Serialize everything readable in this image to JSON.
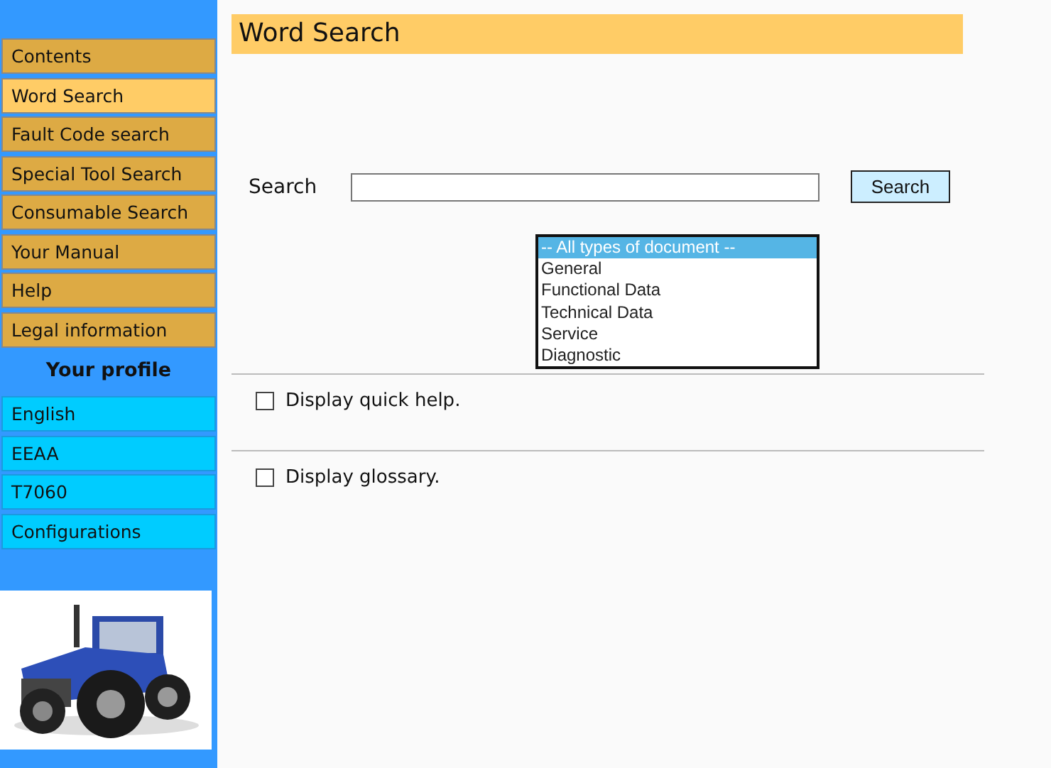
{
  "sidebar": {
    "menu": [
      {
        "label": "Contents",
        "selected": false
      },
      {
        "label": "Word Search",
        "selected": true
      },
      {
        "label": "Fault Code search",
        "selected": false
      },
      {
        "label": "Special Tool Search",
        "selected": false
      },
      {
        "label": "Consumable Search",
        "selected": false
      },
      {
        "label": "Your Manual",
        "selected": false
      },
      {
        "label": "Help",
        "selected": false
      },
      {
        "label": "Legal information",
        "selected": false
      }
    ],
    "profile_title": "Your profile",
    "profile": [
      {
        "label": "English"
      },
      {
        "label": "EEAA"
      },
      {
        "label": "T7060"
      },
      {
        "label": "Configurations"
      }
    ]
  },
  "page_title": "Word Search",
  "search": {
    "label": "Search",
    "button": "Search"
  },
  "document_types": [
    {
      "label": "-- All types of document --",
      "selected": true
    },
    {
      "label": "General",
      "selected": false
    },
    {
      "label": "Functional Data",
      "selected": false
    },
    {
      "label": "Technical Data",
      "selected": false
    },
    {
      "label": "Service",
      "selected": false
    },
    {
      "label": "Diagnostic",
      "selected": false
    }
  ],
  "options": [
    {
      "label": "Display quick help.",
      "checked": false
    },
    {
      "label": "Display glossary.",
      "checked": false
    }
  ]
}
